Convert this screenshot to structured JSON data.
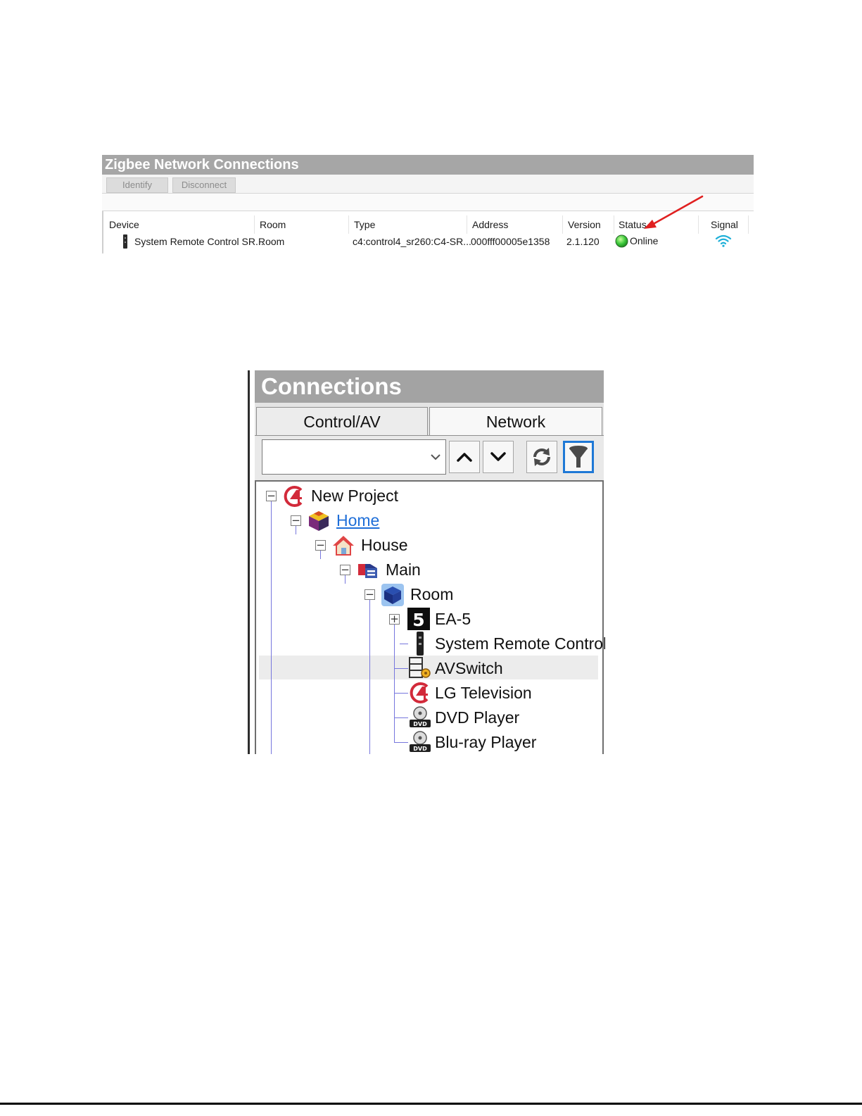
{
  "zigbee": {
    "title": "Zigbee Network Connections",
    "buttons": {
      "identify": "Identify",
      "disconnect": "Disconnect"
    },
    "columns": [
      "Device",
      "Room",
      "Type",
      "Address",
      "Version",
      "Status",
      "Signal"
    ],
    "row": {
      "device": "System Remote Control SR...",
      "room": "Room",
      "type": "c4:control4_sr260:C4-SR...",
      "address": "000fff00005e1358",
      "version": "2.1.120",
      "status": "Online"
    },
    "colors": {
      "status_online": "#3cc83c",
      "signal": "#1fb0d8",
      "annotation_arrow": "#e02020"
    }
  },
  "connections": {
    "title": "Connections",
    "tabs": [
      "Control/AV",
      "Network"
    ],
    "search": {
      "value": ""
    },
    "tree": [
      {
        "label": "New Project",
        "icon": "control4-logo-icon",
        "expander": "minus"
      },
      {
        "label": "Home",
        "icon": "home-cube-icon",
        "expander": "minus",
        "link": true
      },
      {
        "label": "House",
        "icon": "house-icon",
        "expander": "minus"
      },
      {
        "label": "Main",
        "icon": "floor-icon",
        "expander": "minus"
      },
      {
        "label": "Room",
        "icon": "room-cube-icon",
        "expander": "minus"
      },
      {
        "label": "EA-5",
        "icon": "ea5-controller-icon",
        "expander": "plus"
      },
      {
        "label": "System Remote Control",
        "icon": "remote-control-icon"
      },
      {
        "label": "AVSwitch",
        "icon": "av-switch-icon"
      },
      {
        "label": "LG Television",
        "icon": "control4-logo-icon"
      },
      {
        "label": "DVD Player",
        "icon": "disc-player-icon"
      },
      {
        "label": "Blu-ray Player",
        "icon": "disc-player-icon"
      }
    ],
    "colors": {
      "tree_line": "#7777dd",
      "link": "#1f6fd8",
      "filter_border": "#1e78d6"
    }
  }
}
